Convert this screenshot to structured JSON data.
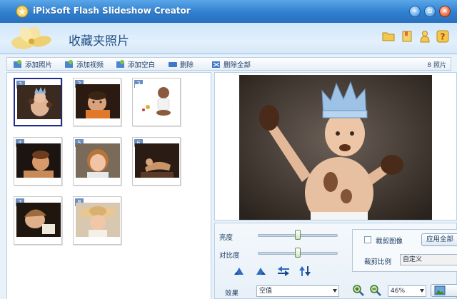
{
  "window": {
    "title": "iPixSoft Flash Slideshow Creator",
    "minimize_label": "–",
    "restore_label": "▫",
    "close_label": "×"
  },
  "header": {
    "page_title": "收藏夹照片",
    "icons": [
      "folder-icon",
      "bookmark-icon",
      "user-icon",
      "help-icon"
    ]
  },
  "toolbar": {
    "items": [
      {
        "label": "添加照片",
        "icon": "add-photo-icon"
      },
      {
        "label": "添加视频",
        "icon": "add-video-icon"
      },
      {
        "label": "添加空白",
        "icon": "add-blank-icon"
      },
      {
        "label": "删除",
        "icon": "delete-icon"
      },
      {
        "label": "删除全部",
        "icon": "delete-all-icon"
      }
    ],
    "photo_count": "8 照片"
  },
  "thumbnails": [
    {
      "num": "1",
      "selected": true
    },
    {
      "num": "2",
      "selected": false
    },
    {
      "num": "3",
      "selected": false
    },
    {
      "num": "4",
      "selected": false
    },
    {
      "num": "5",
      "selected": false
    },
    {
      "num": "6",
      "selected": false
    },
    {
      "num": "7",
      "selected": false
    },
    {
      "num": "8",
      "selected": false
    }
  ],
  "controls": {
    "brightness_label": "亮度",
    "contrast_label": "对比度",
    "brightness_level": 0.5,
    "contrast_level": 0.5,
    "effect_label": "效果",
    "effect_value": "空值",
    "crop_checkbox_label": "裁剪图像",
    "crop_checked": false,
    "apply_all_label": "应用全部",
    "crop_ratio_label": "裁剪比例",
    "crop_ratio_value": "自定义",
    "zoom_value": "46%"
  },
  "colors": {
    "titlebar": "#2f7fcf",
    "header": "#e3f0fc",
    "selected_border": "#1d2c8f",
    "panel_border": "#b9cfe6"
  }
}
